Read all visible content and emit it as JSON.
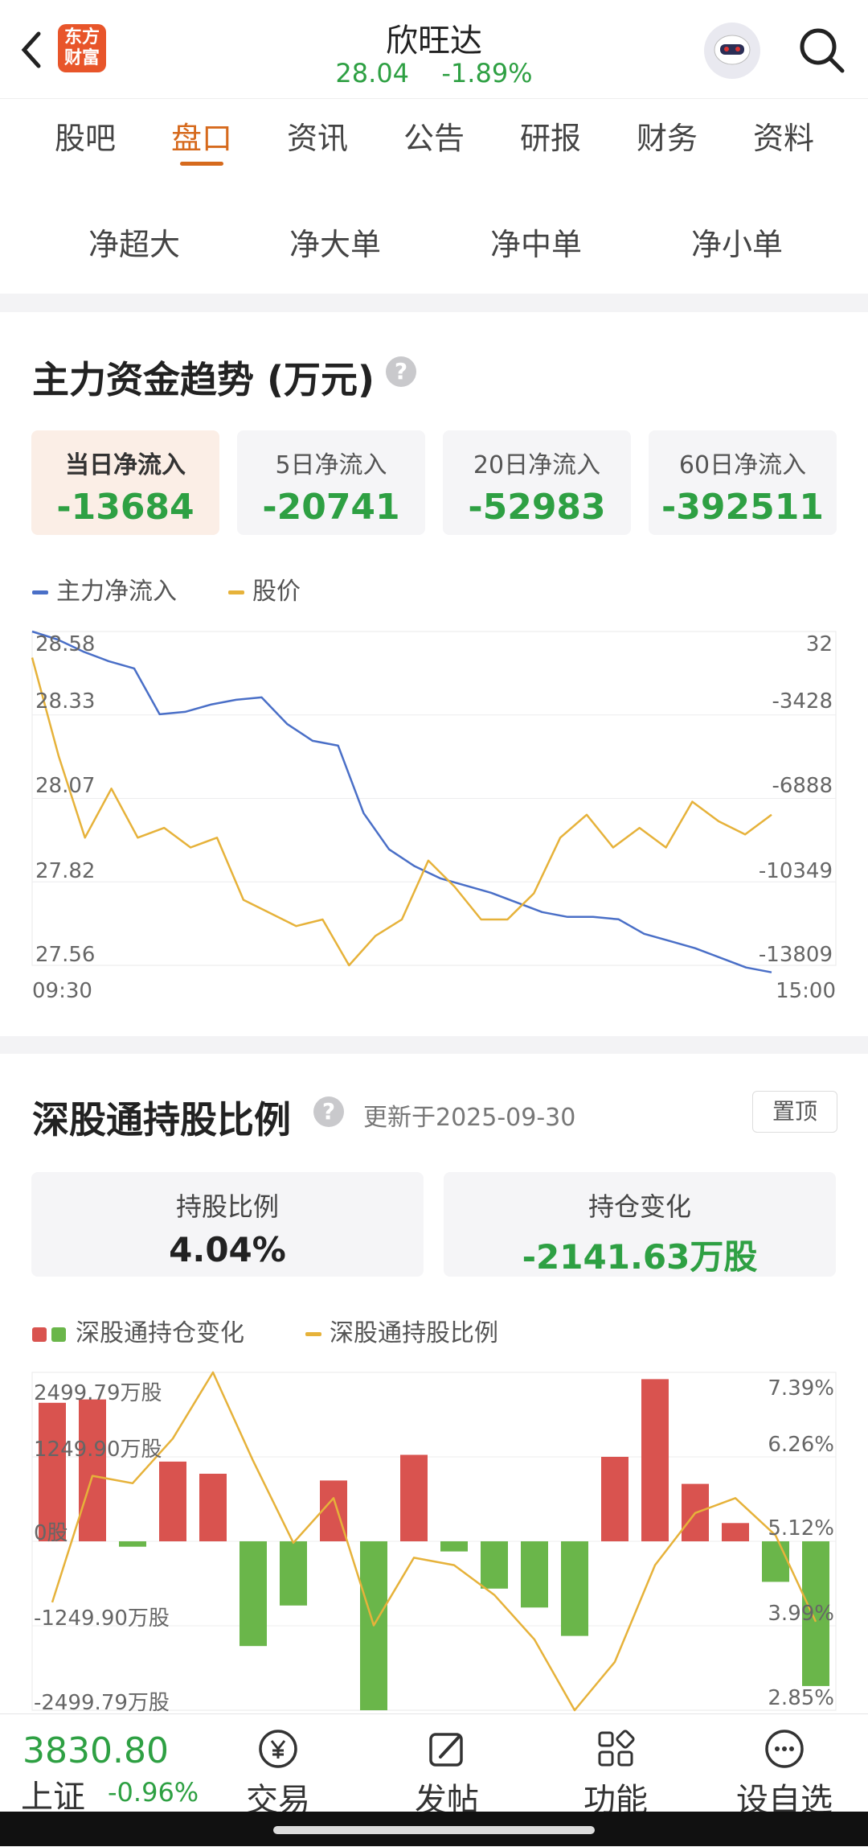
{
  "header": {
    "stock_name": "欣旺达",
    "price": "28.04",
    "change_pct": "-1.89%",
    "logo_line1": "东方",
    "logo_line2": "财富"
  },
  "tabs": [
    "股吧",
    "盘口",
    "资讯",
    "公告",
    "研报",
    "财务",
    "资料"
  ],
  "active_tab": "盘口",
  "flow_tabs": [
    "净超大",
    "净大单",
    "净中单",
    "净小单"
  ],
  "fund_trend": {
    "title": "主力资金趋势 (万元)",
    "help": "?",
    "stats": [
      {
        "label": "当日净流入",
        "value": "-13684"
      },
      {
        "label": "5日净流入",
        "value": "-20741"
      },
      {
        "label": "20日净流入",
        "value": "-52983"
      },
      {
        "label": "60日净流入",
        "value": "-392511"
      }
    ],
    "legend_flow": "主力净流入",
    "legend_price": "股价",
    "price_ticks": [
      "28.58",
      "28.33",
      "28.07",
      "27.82",
      "27.56"
    ],
    "flow_ticks": [
      "32",
      "-3428",
      "-6888",
      "-10349",
      "-13809"
    ],
    "time_start": "09:30",
    "time_end": "15:00"
  },
  "hk_holding": {
    "title": "深股通持股比例",
    "help": "?",
    "updated": "更新于2025-09-30",
    "pin_button": "置顶",
    "ratio_label": "持股比例",
    "ratio_value": "4.04%",
    "change_label": "持仓变化",
    "change_value": "-2141.63万股",
    "legend_change": "深股通持仓变化",
    "legend_ratio": "深股通持股比例",
    "left_ticks": [
      "2499.79万股",
      "1249.90万股",
      "0股",
      "-1249.90万股",
      "-2499.79万股"
    ],
    "right_ticks": [
      "7.39%",
      "6.26%",
      "5.12%",
      "3.99%",
      "2.85%"
    ]
  },
  "bottom_bar": {
    "index_value": "3830.80",
    "index_name": "上证",
    "index_change": "-0.96%",
    "nav": [
      "交易",
      "发帖",
      "功能",
      "设自选"
    ]
  },
  "colors": {
    "green": "#2ea043",
    "red": "#d9534f",
    "bar_green": "#6ab64a",
    "blue": "#4a6fc7",
    "gold": "#e6b23a",
    "accent": "#d66a1d"
  },
  "chart_data": [
    {
      "type": "line",
      "x_range": [
        "09:30",
        "15:00"
      ],
      "series": [
        {
          "name": "主力净流入",
          "axis": "right",
          "values": [
            32,
            -300,
            -800,
            -1200,
            -1500,
            -3400,
            -3300,
            -3000,
            -2800,
            -2700,
            -3800,
            -4500,
            -4700,
            -7500,
            -9000,
            -9700,
            -10200,
            -10500,
            -10800,
            -11200,
            -11600,
            -11800,
            -11800,
            -11900,
            -12500,
            -12800,
            -13100,
            -13500,
            -13900,
            -14100
          ]
        },
        {
          "name": "股价",
          "axis": "left",
          "values": [
            28.5,
            28.2,
            27.95,
            28.1,
            27.95,
            27.98,
            27.92,
            27.95,
            27.76,
            27.72,
            27.68,
            27.7,
            27.56,
            27.65,
            27.7,
            27.88,
            27.8,
            27.7,
            27.7,
            27.78,
            27.95,
            28.02,
            27.92,
            27.98,
            27.92,
            28.06,
            28.0,
            27.96,
            28.02
          ]
        }
      ],
      "ylim_left": [
        27.56,
        28.58
      ],
      "ylim_right": [
        -13809,
        32
      ]
    },
    {
      "type": "bar",
      "series": [
        {
          "name": "深股通持仓变化",
          "axis": "left",
          "values": [
            2050,
            2100,
            -80,
            1180,
            1000,
            -1550,
            -950,
            900,
            -2500,
            1280,
            -150,
            -700,
            -980,
            -1400,
            1250,
            2400,
            850,
            270,
            -600,
            -2141.63
          ]
        },
        {
          "name": "深股通持股比例",
          "type": "line",
          "axis": "right",
          "values": [
            4.3,
            6.0,
            5.9,
            6.5,
            7.39,
            6.2,
            5.1,
            5.7,
            3.99,
            4.9,
            4.8,
            4.4,
            3.8,
            2.85,
            3.5,
            4.8,
            5.5,
            5.7,
            5.2,
            4.04
          ]
        }
      ],
      "ylim_left": [
        -2499.79,
        2499.79
      ],
      "ylim_right": [
        2.85,
        7.39
      ]
    }
  ]
}
